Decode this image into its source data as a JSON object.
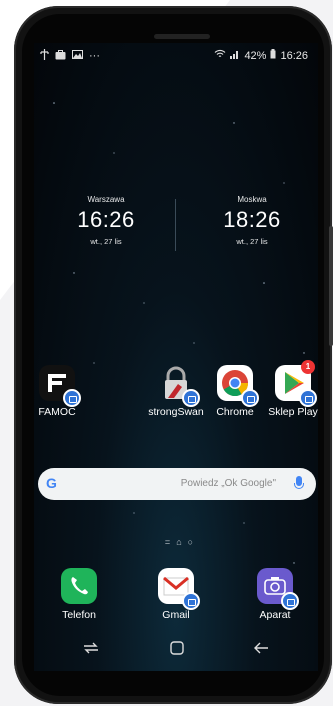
{
  "status_bar": {
    "battery": "42%",
    "time": "16:26",
    "overflow": "···"
  },
  "clocks": [
    {
      "city": "Warszawa",
      "time": "16:26",
      "date": "wt., 27 lis"
    },
    {
      "city": "Moskwa",
      "time": "18:26",
      "date": "wt., 27 lis"
    }
  ],
  "apps_row": [
    {
      "label": "FAMOC",
      "icon": "famoc-icon"
    },
    {
      "label": "strongSwan",
      "icon": "strongswan-icon"
    },
    {
      "label": "Chrome",
      "icon": "chrome-icon"
    },
    {
      "label": "Sklep Play",
      "icon": "play-store-icon",
      "notification": "1"
    }
  ],
  "search": {
    "placeholder": "Powiedz „Ok Google\""
  },
  "dock": [
    {
      "label": "Telefon",
      "icon": "phone-icon"
    },
    {
      "label": "Gmail",
      "icon": "gmail-icon"
    },
    {
      "label": "Aparat",
      "icon": "camera-icon"
    }
  ],
  "colors": {
    "work_badge": "#2f73d6",
    "phone_green": "#1fb45a",
    "camera_purple": "#6a5acd",
    "notification_red": "#e33333"
  }
}
